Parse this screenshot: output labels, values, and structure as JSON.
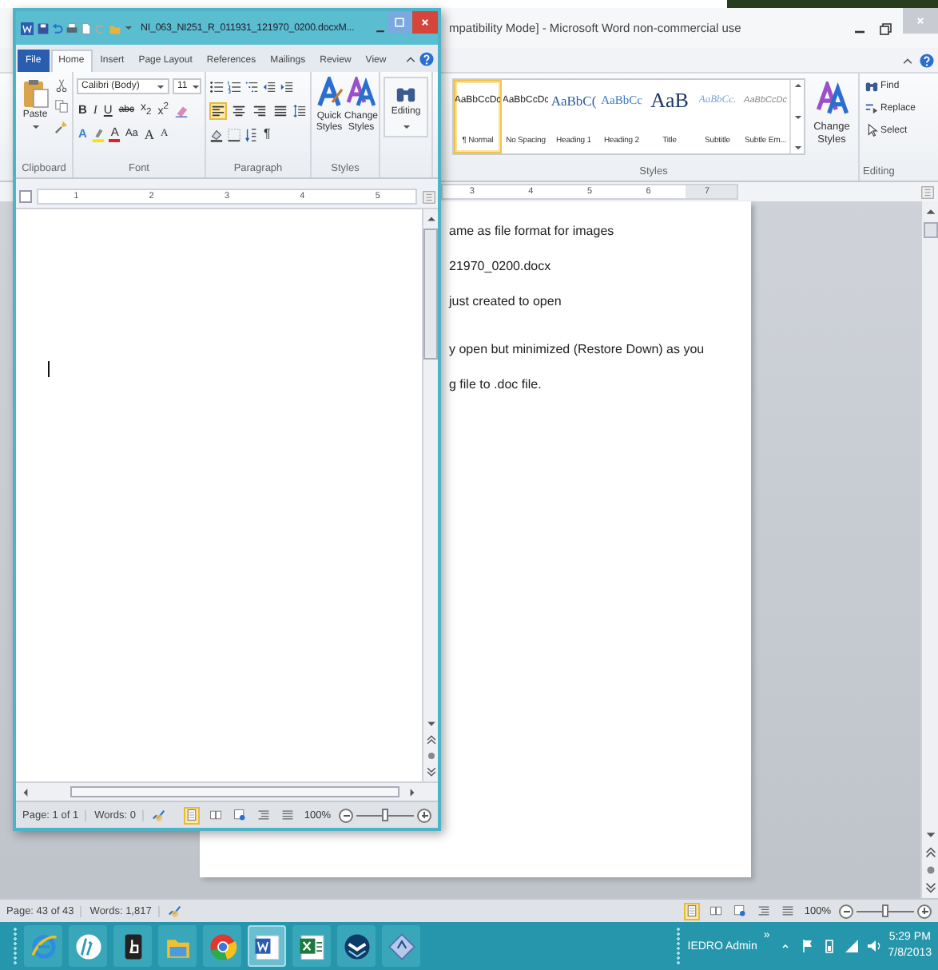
{
  "back_window": {
    "title": "mpatibility Mode] - Microsoft Word non-commercial use",
    "styles": [
      {
        "preview": "AaBbCcDc",
        "label": "¶ Normal",
        "kind": "normal",
        "selected": true
      },
      {
        "preview": "AaBbCcDc",
        "label": "No Spacing",
        "kind": "normal",
        "selected": false
      },
      {
        "preview": "AaBbC(",
        "label": "Heading 1",
        "kind": "heading1",
        "selected": false
      },
      {
        "preview": "AaBbCc",
        "label": "Heading 2",
        "kind": "heading2",
        "selected": false
      },
      {
        "preview": "AaB",
        "label": "Title",
        "kind": "title",
        "selected": false
      },
      {
        "preview": "AaBbCc.",
        "label": "Subtitle",
        "kind": "subtitle",
        "selected": false
      },
      {
        "preview": "AaBbCcDc",
        "label": "Subtle Em...",
        "kind": "subtle",
        "selected": false
      }
    ],
    "change_styles": "Change Styles",
    "styles_group": "Styles",
    "editing": [
      "Find",
      "Replace",
      "Select"
    ],
    "editing_group": "Editing",
    "ruler": [
      "3",
      "4",
      "5",
      "6",
      "7"
    ],
    "document_lines": [
      "ame as file format for images",
      "21970_0200.docx",
      "just created to open",
      "y open but minimized (Restore Down) as you",
      "g file to .doc file."
    ],
    "status": {
      "page": "Page: 43 of 43",
      "words": "Words: 1,817",
      "zoom": "100%",
      "zoom_slider": {
        "level": 0.5
      },
      "view_buttons": [
        {
          "selected": true
        },
        {
          "selected": false
        },
        {
          "selected": false
        },
        {
          "selected": false
        },
        {
          "selected": false
        }
      ]
    }
  },
  "front_window": {
    "title": "NI_063_NI251_R_011931_121970_0200.docxM...",
    "tabs": [
      {
        "label": "File",
        "kind": "file",
        "selected": false
      },
      {
        "label": "Home",
        "kind": "tab",
        "selected": true
      },
      {
        "label": "Insert",
        "kind": "tab",
        "selected": false
      },
      {
        "label": "Page Layout",
        "kind": "tab",
        "selected": false
      },
      {
        "label": "References",
        "kind": "tab",
        "selected": false
      },
      {
        "label": "Mailings",
        "kind": "tab",
        "selected": false
      },
      {
        "label": "Review",
        "kind": "tab",
        "selected": false
      },
      {
        "label": "View",
        "kind": "tab",
        "selected": false
      }
    ],
    "paste": "Paste",
    "clipboard_group": "Clipboard",
    "font_name": "Calibri (Body)",
    "font_size": "11",
    "format_buttons": [
      "B",
      "I",
      "U",
      "abc",
      "x$_{2}$",
      "x$^{2}$"
    ],
    "effect_buttons": [
      {
        "label": "A",
        "kind": "effects"
      },
      {
        "kind": "highlight"
      },
      {
        "label": "A",
        "kind": "color"
      },
      {
        "label": "Aa",
        "kind": "case"
      },
      {
        "label": "A",
        "kind": "grow"
      },
      {
        "label": "A",
        "kind": "shrink"
      }
    ],
    "font_group": "Font",
    "align_buttons": [
      {
        "kind": "left",
        "selected": true
      },
      {
        "kind": "center",
        "selected": false
      },
      {
        "kind": "right",
        "selected": false
      },
      {
        "kind": "justify",
        "selected": false
      }
    ],
    "pilcrow": "¶",
    "paragraph_group": "Paragraph",
    "quick_styles": "Quick Styles",
    "change_styles": "Change Styles",
    "styles_group": "Styles",
    "editing": "Editing",
    "ruler": [
      "1",
      "2",
      "3",
      "4",
      "5"
    ],
    "status": {
      "page": "Page: 1 of 1",
      "words": "Words: 0",
      "zoom": "100%",
      "zoom_slider": {
        "level": 0.5
      },
      "view_buttons": [
        {
          "selected": true
        },
        {
          "selected": false
        },
        {
          "selected": false
        },
        {
          "selected": false
        },
        {
          "selected": false
        }
      ]
    }
  },
  "taskbar": {
    "apps": [
      {
        "kind": "ie",
        "selected": false
      },
      {
        "kind": "hp",
        "selected": false
      },
      {
        "kind": "touch",
        "selected": false
      },
      {
        "kind": "folder",
        "selected": false
      },
      {
        "kind": "chrome",
        "selected": false
      },
      {
        "kind": "word",
        "selected": true
      },
      {
        "kind": "excel",
        "selected": false
      },
      {
        "kind": "chevron",
        "selected": false
      },
      {
        "kind": "remote",
        "selected": false
      }
    ],
    "user": "IEDRO Admin",
    "overflow": "»",
    "time": "5:29 PM",
    "date": "7/8/2013"
  }
}
